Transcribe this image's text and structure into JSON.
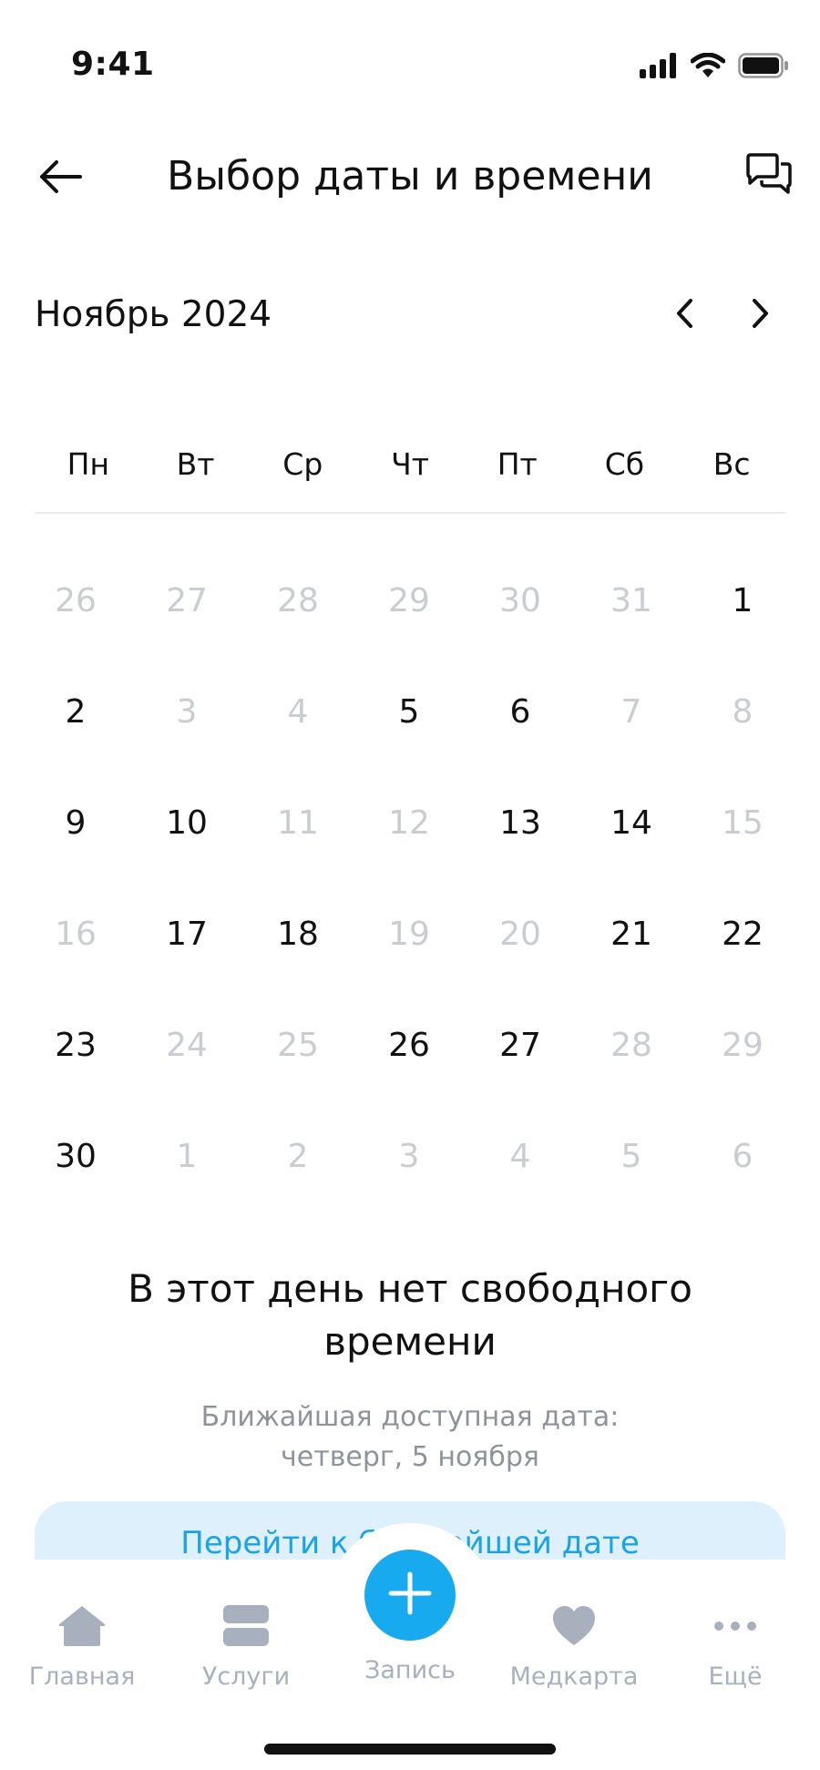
{
  "status_bar": {
    "time": "9:41"
  },
  "header": {
    "title": "Выбор даты и времени"
  },
  "calendar": {
    "month_label": "Ноябрь 2024",
    "weekdays": [
      "Пн",
      "Вт",
      "Ср",
      "Чт",
      "Пт",
      "Сб",
      "Вс"
    ],
    "days": [
      {
        "label": "26",
        "available": false
      },
      {
        "label": "27",
        "available": false
      },
      {
        "label": "28",
        "available": false
      },
      {
        "label": "29",
        "available": false
      },
      {
        "label": "30",
        "available": false
      },
      {
        "label": "31",
        "available": false
      },
      {
        "label": "1",
        "available": true
      },
      {
        "label": "2",
        "available": true
      },
      {
        "label": "3",
        "available": false
      },
      {
        "label": "4",
        "available": false
      },
      {
        "label": "5",
        "available": true
      },
      {
        "label": "6",
        "available": true
      },
      {
        "label": "7",
        "available": false
      },
      {
        "label": "8",
        "available": false
      },
      {
        "label": "9",
        "available": true
      },
      {
        "label": "10",
        "available": true
      },
      {
        "label": "11",
        "available": false
      },
      {
        "label": "12",
        "available": false
      },
      {
        "label": "13",
        "available": true
      },
      {
        "label": "14",
        "available": true
      },
      {
        "label": "15",
        "available": false
      },
      {
        "label": "16",
        "available": false
      },
      {
        "label": "17",
        "available": true
      },
      {
        "label": "18",
        "available": true
      },
      {
        "label": "19",
        "available": false
      },
      {
        "label": "20",
        "available": false
      },
      {
        "label": "21",
        "available": true
      },
      {
        "label": "22",
        "available": true
      },
      {
        "label": "23",
        "available": true
      },
      {
        "label": "24",
        "available": false
      },
      {
        "label": "25",
        "available": false
      },
      {
        "label": "26",
        "available": true
      },
      {
        "label": "27",
        "available": true
      },
      {
        "label": "28",
        "available": false
      },
      {
        "label": "29",
        "available": false
      },
      {
        "label": "30",
        "available": true
      },
      {
        "label": "1",
        "available": false
      },
      {
        "label": "2",
        "available": false
      },
      {
        "label": "3",
        "available": false
      },
      {
        "label": "4",
        "available": false
      },
      {
        "label": "5",
        "available": false
      },
      {
        "label": "6",
        "available": false
      }
    ]
  },
  "message": {
    "title": "В этот день нет свободного времени",
    "subtitle_line1": "Ближайшая доступная дата:",
    "subtitle_line2": "четверг, 5 ноября",
    "button_label": "Перейти к ближайшей дате"
  },
  "tabbar": {
    "tabs": [
      {
        "label": "Главная",
        "icon": "home-icon"
      },
      {
        "label": "Услуги",
        "icon": "services-icon"
      },
      {
        "label": "Запись",
        "icon": "plus-icon"
      },
      {
        "label": "Медкарта",
        "icon": "heart-icon"
      },
      {
        "label": "Ещё",
        "icon": "more-icon"
      }
    ]
  },
  "colors": {
    "accent": "#17aaee",
    "button_bg": "#def0fb",
    "muted_text": "#c9ccd1",
    "tab_inactive": "#a9b0bd"
  }
}
